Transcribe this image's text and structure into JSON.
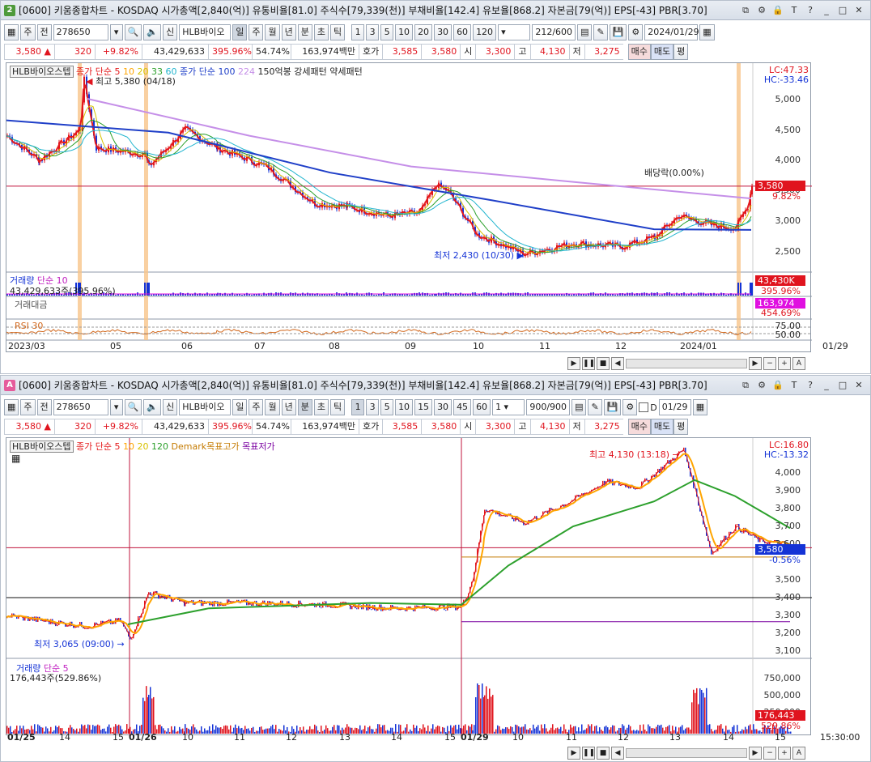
{
  "top": {
    "badge": "2",
    "title": "[0600] 키움종합차트 - KOSDAQ 시가총액[2,840(억)] 유통비율[81.0] 주식수[79,339(천)] 부채비율[142.4] 유보율[868.2] 자본금[79(억)] EPS[-43] PBR[3.70]",
    "toolbar": {
      "mode1": "주",
      "mode2": "전",
      "code": "278650",
      "name": "HLB바이오",
      "periods": [
        "일",
        "주",
        "월",
        "년",
        "분",
        "초",
        "틱"
      ],
      "nums": [
        "1",
        "3",
        "5",
        "10",
        "20",
        "30",
        "60",
        "120"
      ],
      "count": "212/600",
      "date": "2024/01/29"
    },
    "quote": {
      "price": "3,580",
      "arrow": "▲",
      "change": "320",
      "rate": "+9.82%",
      "volume": "43,429,633",
      "vol_rate": "395.96%",
      "turn": "54.74%",
      "amount": "163,974백만",
      "bid_label": "호가",
      "bid": "3,585",
      "ask": "3,580",
      "open_label": "시",
      "open": "3,300",
      "high_label": "고",
      "high": "4,130",
      "low_label": "저",
      "low": "3,275",
      "buy": "매수",
      "sell": "매도",
      "eval": "평"
    },
    "legend": {
      "name": "HLB바이오스텝",
      "ma_label": "종가 단순 5",
      "ma10": "10",
      "ma20": "20",
      "ma33": "33",
      "ma60": "60",
      "ma100": "종가 단순 100",
      "ma224": "224",
      "pattern": "150억봉 강세패턴",
      "weak": "약세패턴"
    },
    "notes": {
      "max": "최고 5,380 (04/18)",
      "min": "최저 2,430 (10/30)",
      "div": "배당락(0.00%)"
    },
    "yaxis": [
      "5,000",
      "4,500",
      "4,000",
      "3,500",
      "3,000",
      "2,500"
    ],
    "tags": {
      "lc": "LC:47.33",
      "hc": "HC:-33.46",
      "price": "3,580",
      "pct": "9.82%"
    },
    "volume": {
      "label": "거래량",
      "ma": "단순 10",
      "value": "43,429,633주(395.96%)",
      "tag": "43,430K",
      "tag2": "395.96%"
    },
    "amount": {
      "label": "거래대금",
      "tag": "163,974",
      "tag2": "454.69%"
    },
    "rsi": {
      "label": "RSI 30",
      "l75": "75.00",
      "l50": "50.00"
    },
    "xaxis": [
      "2023/03",
      "05",
      "06",
      "07",
      "08",
      "09",
      "10",
      "11",
      "12",
      "2024/01",
      "01/29"
    ],
    "colors": {
      "up": "#e0141e",
      "down": "#1433d6",
      "ma5": "#e41a1c",
      "ma10": "#ffa500",
      "ma20": "#d7c200",
      "ma33": "#2ca02c",
      "ma60": "#22b5cf",
      "ma100": "#1f3fc8",
      "ma224": "#c58fe8"
    }
  },
  "bottom": {
    "badge": "A",
    "title": "[0600] 키움종합차트 - KOSDAQ 시가총액[2,840(억)] 유통비율[81.0] 주식수[79,339(천)] 부채비율[142.4] 유보율[868.2] 자본금[79(억)] EPS[-43] PBR[3.70]",
    "toolbar": {
      "mode1": "주",
      "mode2": "전",
      "code": "278650",
      "name": "HLB바이오",
      "periods": [
        "일",
        "주",
        "월",
        "년",
        "분",
        "초",
        "틱"
      ],
      "nums": [
        "1",
        "3",
        "5",
        "10",
        "15",
        "30",
        "45",
        "60"
      ],
      "interval": "1",
      "count": "900/900",
      "d_label": "D",
      "date": "01/29"
    },
    "quote": {
      "price": "3,580",
      "arrow": "▲",
      "change": "320",
      "rate": "+9.82%",
      "volume": "43,429,633",
      "vol_rate": "395.96%",
      "turn": "54.74%",
      "amount": "163,974백만",
      "bid_label": "호가",
      "bid": "3,585",
      "ask": "3,580",
      "open_label": "시",
      "open": "3,300",
      "high_label": "고",
      "high": "4,130",
      "low_label": "저",
      "low": "3,275",
      "buy": "매수",
      "sell": "매도",
      "eval": "평"
    },
    "legend": {
      "name": "HLB바이오스텝",
      "ma_label": "종가 단순 5",
      "ma10": "10",
      "ma20": "20",
      "ma120": "120",
      "demark": "Demark목표고가",
      "demark_low": "목표저가"
    },
    "notes": {
      "max": "최고 4,130 (13:18)",
      "min": "최저 3,065 (09:00)"
    },
    "yaxis": [
      "4,000",
      "3,900",
      "3,800",
      "3,700",
      "3,600",
      "3,500",
      "3,400",
      "3,300",
      "3,200",
      "3,100"
    ],
    "tags": {
      "lc": "LC:16.80",
      "hc": "HC:-13.32",
      "price": "3,580",
      "pct": "-0.56%"
    },
    "volume": {
      "label": "거래량",
      "ma": "단순 5",
      "value": "176,443주(529.86%)",
      "tag": "176,443",
      "tag2": "529.86%"
    },
    "vaxis": [
      "750,000",
      "500,000",
      "250,000"
    ],
    "xaxis": [
      "01/25",
      "14",
      "15",
      "01/26",
      "10",
      "11",
      "12",
      "13",
      "14",
      "15",
      "01/29",
      "10",
      "11",
      "12",
      "13",
      "14",
      "15",
      "15:30:00"
    ]
  }
}
